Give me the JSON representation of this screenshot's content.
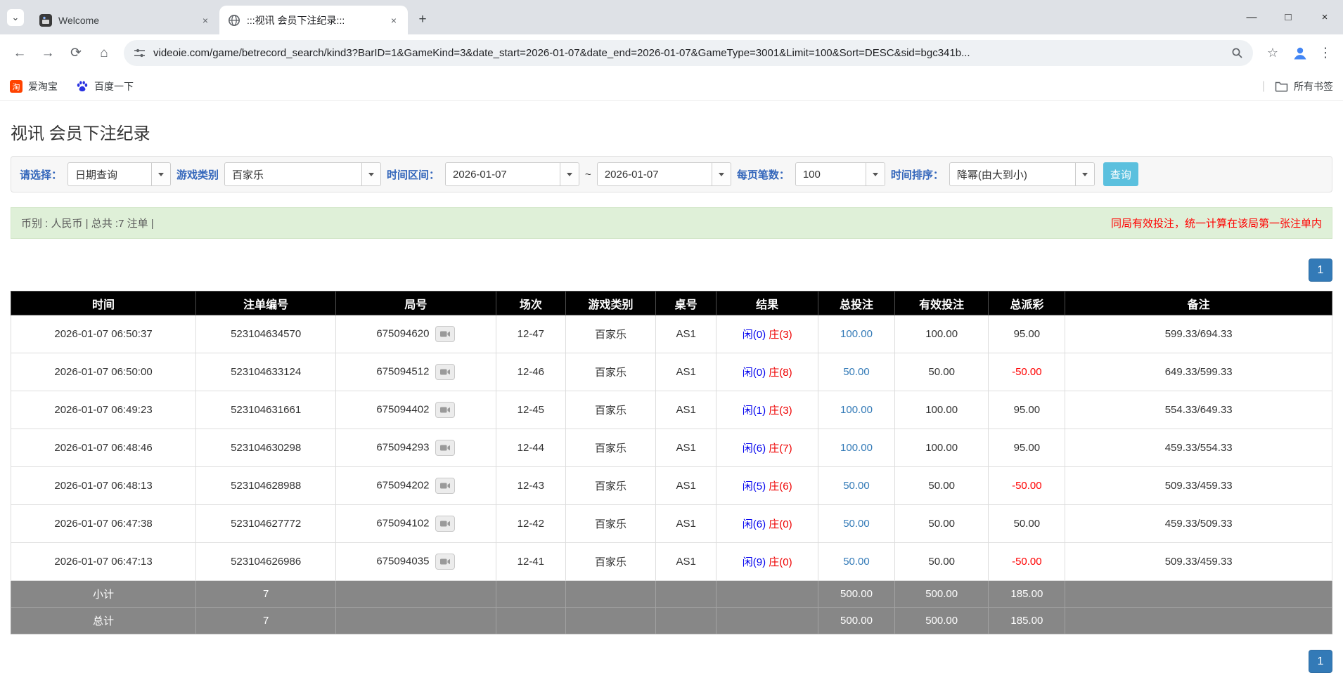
{
  "browser": {
    "tabs": [
      {
        "title": "Welcome"
      },
      {
        "title": ":::视讯 会员下注纪录:::"
      }
    ],
    "url": "videoie.com/game/betrecord_search/kind3?BarID=1&GameKind=3&date_start=2026-01-07&date_end=2026-01-07&GameType=3001&Limit=100&Sort=DESC&sid=bgc341b...",
    "bookmarks": [
      {
        "label": "爱淘宝"
      },
      {
        "label": "百度一下"
      }
    ],
    "all_bookmarks_label": "所有书签",
    "controls": {
      "minimize": "—",
      "maximize": "□",
      "close": "×",
      "new_tab": "+",
      "tab_search": "⌄",
      "back": "←",
      "forward": "→",
      "reload": "⟳",
      "home": "⌂",
      "star": "☆",
      "menu": "⋮",
      "tab_close": "×"
    }
  },
  "page": {
    "title": "视讯 会员下注纪录",
    "filters": {
      "select_label": "请选择：",
      "select_value": "日期查询",
      "game_kind_label": "游戏类别",
      "game_kind_value": "百家乐",
      "date_range_label": "时间区间：",
      "date_start": "2026-01-07",
      "date_separator": "~",
      "date_end": "2026-01-07",
      "page_size_label": "每页笔数：",
      "page_size_value": "100",
      "sort_label": "时间排序：",
      "sort_value": "降幂(由大到小)",
      "search_button": "查询"
    },
    "summary": {
      "left": "币别 : 人民币 | 总共 :7 注单 |",
      "right": "同局有效投注，统一计算在该局第一张注单内"
    },
    "pagination": {
      "page": "1"
    },
    "table": {
      "headers": [
        "时间",
        "注单编号",
        "局号",
        "场次",
        "游戏类别",
        "桌号",
        "结果",
        "总投注",
        "有效投注",
        "总派彩",
        "备注"
      ],
      "rows": [
        {
          "time": "2026-01-07 06:50:37",
          "bet_id": "523104634570",
          "round_no": "675094620",
          "session": "12-47",
          "game_kind": "百家乐",
          "table_no": "AS1",
          "result_player": "闲(0)",
          "result_banker": "庄(3)",
          "total_bet": "100.00",
          "valid_bet": "100.00",
          "payout": "95.00",
          "note": "599.33/694.33"
        },
        {
          "time": "2026-01-07 06:50:00",
          "bet_id": "523104633124",
          "round_no": "675094512",
          "session": "12-46",
          "game_kind": "百家乐",
          "table_no": "AS1",
          "result_player": "闲(0)",
          "result_banker": "庄(8)",
          "total_bet": "50.00",
          "valid_bet": "50.00",
          "payout": "-50.00",
          "note": "649.33/599.33"
        },
        {
          "time": "2026-01-07 06:49:23",
          "bet_id": "523104631661",
          "round_no": "675094402",
          "session": "12-45",
          "game_kind": "百家乐",
          "table_no": "AS1",
          "result_player": "闲(1)",
          "result_banker": "庄(3)",
          "total_bet": "100.00",
          "valid_bet": "100.00",
          "payout": "95.00",
          "note": "554.33/649.33"
        },
        {
          "time": "2026-01-07 06:48:46",
          "bet_id": "523104630298",
          "round_no": "675094293",
          "session": "12-44",
          "game_kind": "百家乐",
          "table_no": "AS1",
          "result_player": "闲(6)",
          "result_banker": "庄(7)",
          "total_bet": "100.00",
          "valid_bet": "100.00",
          "payout": "95.00",
          "note": "459.33/554.33"
        },
        {
          "time": "2026-01-07 06:48:13",
          "bet_id": "523104628988",
          "round_no": "675094202",
          "session": "12-43",
          "game_kind": "百家乐",
          "table_no": "AS1",
          "result_player": "闲(5)",
          "result_banker": "庄(6)",
          "total_bet": "50.00",
          "valid_bet": "50.00",
          "payout": "-50.00",
          "note": "509.33/459.33"
        },
        {
          "time": "2026-01-07 06:47:38",
          "bet_id": "523104627772",
          "round_no": "675094102",
          "session": "12-42",
          "game_kind": "百家乐",
          "table_no": "AS1",
          "result_player": "闲(6)",
          "result_banker": "庄(0)",
          "total_bet": "50.00",
          "valid_bet": "50.00",
          "payout": "50.00",
          "note": "459.33/509.33"
        },
        {
          "time": "2026-01-07 06:47:13",
          "bet_id": "523104626986",
          "round_no": "675094035",
          "session": "12-41",
          "game_kind": "百家乐",
          "table_no": "AS1",
          "result_player": "闲(9)",
          "result_banker": "庄(0)",
          "total_bet": "50.00",
          "valid_bet": "50.00",
          "payout": "-50.00",
          "note": "509.33/459.33"
        }
      ],
      "subtotal_row": [
        "小计",
        "7",
        "",
        "",
        "",
        "",
        "",
        "500.00",
        "500.00",
        "185.00",
        ""
      ],
      "total_row": [
        "总计",
        "7",
        "",
        "",
        "",
        "",
        "",
        "500.00",
        "500.00",
        "185.00",
        ""
      ]
    }
  }
}
